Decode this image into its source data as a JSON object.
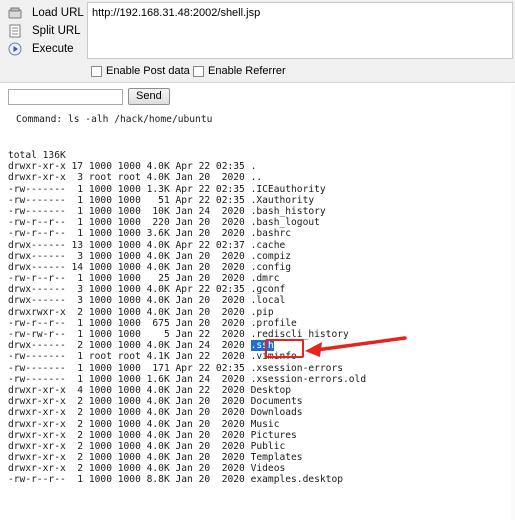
{
  "menu": {
    "load_url": "Load URL",
    "split_url": "Split URL",
    "execute": "Execute"
  },
  "url_box": {
    "value": "http://192.168.31.48:2002/shell.jsp"
  },
  "options": {
    "post_data": "Enable Post data",
    "referrer": "Enable Referrer"
  },
  "command_form": {
    "input_value": "",
    "send_label": "Send"
  },
  "output": {
    "command_line": "Command: ls -alh /hack/home/ubuntu",
    "lines": [
      "total 136K",
      "drwxr-xr-x 17 1000 1000 4.0K Apr 22 02:35 .",
      "drwxr-xr-x  3 root root 4.0K Jan 20  2020 ..",
      "-rw-------  1 1000 1000 1.3K Apr 22 02:35 .ICEauthority",
      "-rw-------  1 1000 1000   51 Apr 22 02:35 .Xauthority",
      "-rw-------  1 1000 1000  10K Jan 24  2020 .bash_history",
      "-rw-r--r--  1 1000 1000  220 Jan 20  2020 .bash_logout",
      "-rw-r--r--  1 1000 1000 3.6K Jan 20  2020 .bashrc",
      "drwx------ 13 1000 1000 4.0K Apr 22 02:37 .cache",
      "drwx------  3 1000 1000 4.0K Jan 20  2020 .compiz",
      "drwx------ 14 1000 1000 4.0K Jan 20  2020 .config",
      "-rw-r--r--  1 1000 1000   25 Jan 20  2020 .dmrc",
      "drwx------  3 1000 1000 4.0K Apr 22 02:35 .gconf",
      "drwx------  3 1000 1000 4.0K Jan 20  2020 .local",
      "drwxrwxr-x  2 1000 1000 4.0K Jan 20  2020 .pip",
      "-rw-r--r--  1 1000 1000  675 Jan 20  2020 .profile",
      "-rw-rw-r--  1 1000 1000    5 Jan 22  2020 .rediscli_history",
      "drwx------  2 1000 1000 4.0K Jan 24  2020 ",
      "-rw-------  1 root root 4.1K Jan 22  2020 .viminfo",
      "-rw-------  1 1000 1000  171 Apr 22 02:35 .xsession-errors",
      "-rw-------  1 1000 1000 1.6K Jan 24  2020 .xsession-errors.old",
      "drwxr-xr-x  4 1000 1000 4.0K Jan 22  2020 Desktop",
      "drwxr-xr-x  2 1000 1000 4.0K Jan 20  2020 Documents",
      "drwxr-xr-x  2 1000 1000 4.0K Jan 20  2020 Downloads",
      "drwxr-xr-x  2 1000 1000 4.0K Jan 20  2020 Music",
      "drwxr-xr-x  2 1000 1000 4.0K Jan 20  2020 Pictures",
      "drwxr-xr-x  2 1000 1000 4.0K Jan 20  2020 Public",
      "drwxr-xr-x  2 1000 1000 4.0K Jan 20  2020 Templates",
      "drwxr-xr-x  2 1000 1000 4.0K Jan 20  2020 Videos",
      "-rw-r--r--  1 1000 1000 8.8K Jan 20  2020 examples.desktop"
    ],
    "highlighted_entry": ".ssh"
  },
  "annotation": {
    "box_color": "#e8231d",
    "highlight_color": "#1f6fd1"
  }
}
